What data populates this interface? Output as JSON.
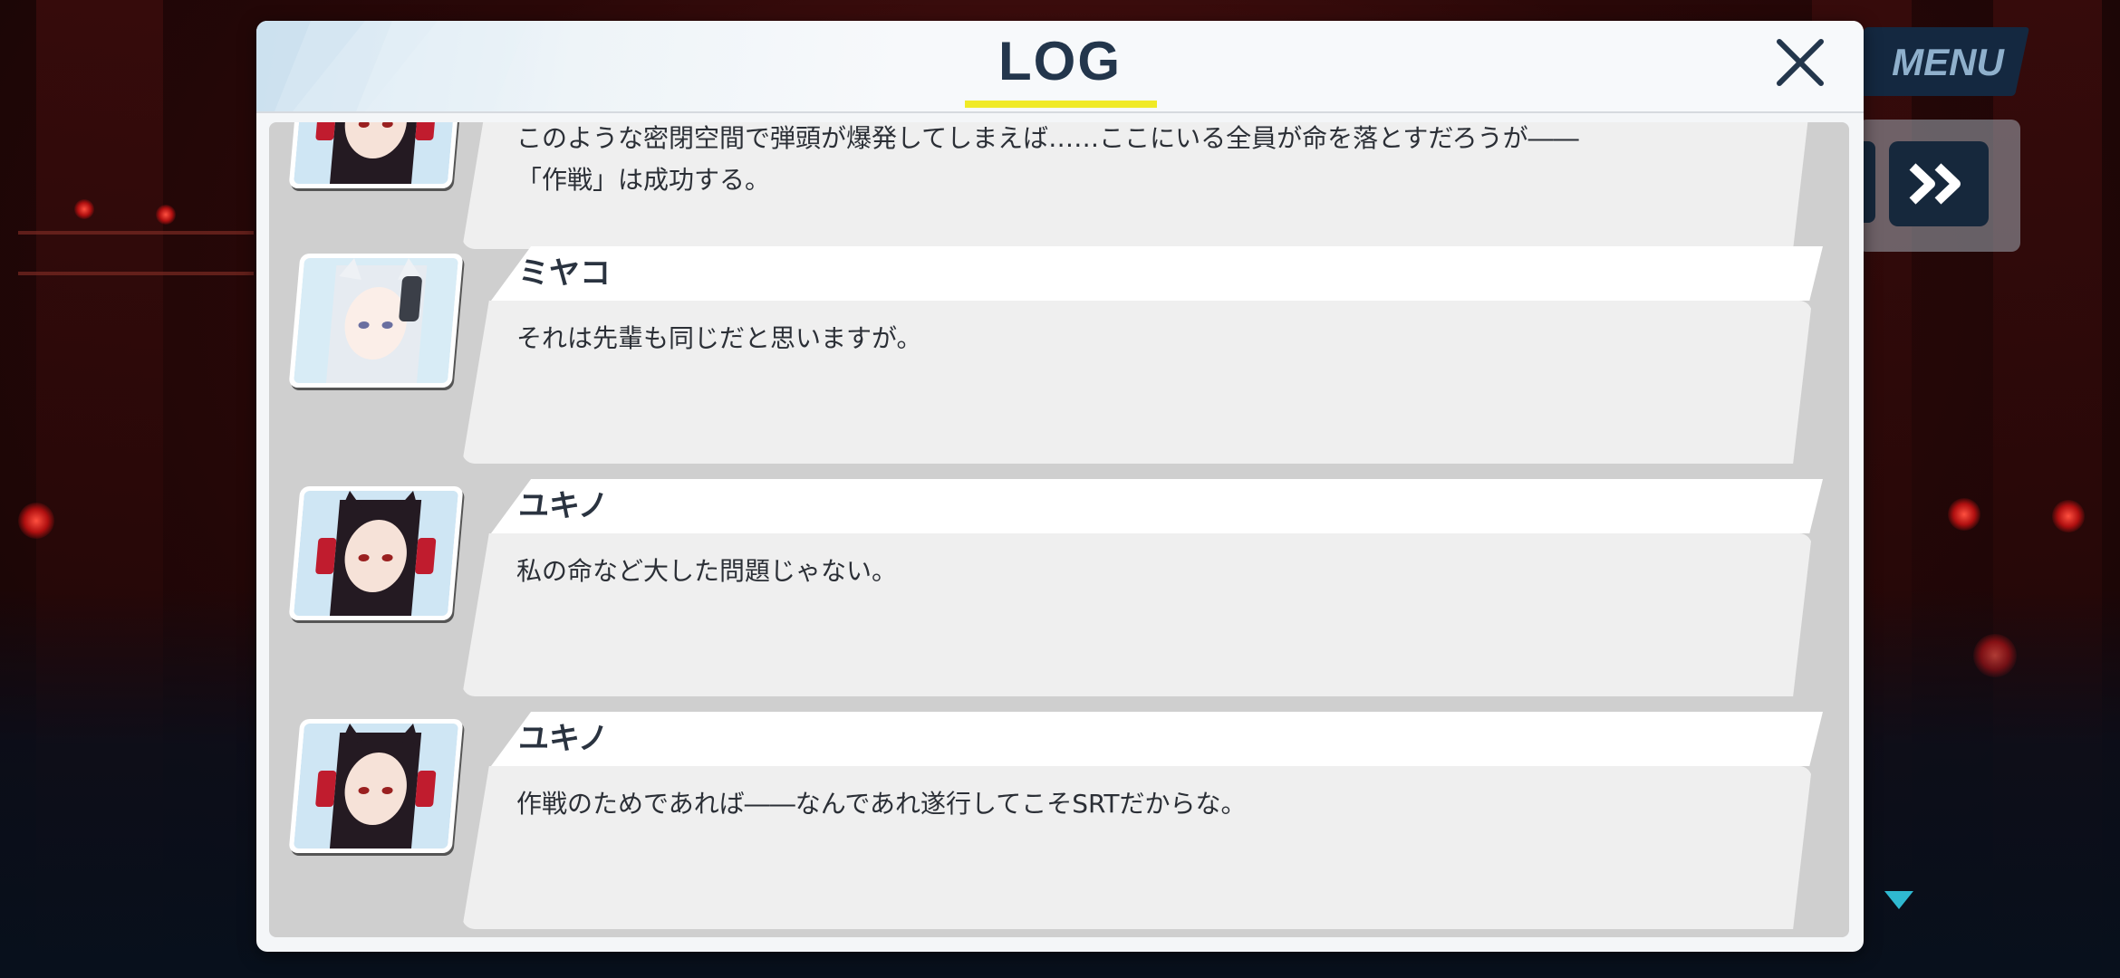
{
  "header": {
    "title": "LOG",
    "close_label": "×"
  },
  "controls": {
    "menu_label": "MENU",
    "fast_forward_label": "»"
  },
  "entries": [
    {
      "speaker": "",
      "portrait": "yukino-portrait",
      "text": "このような密閉空間で弾頭が爆発してしまえば……ここにいる全員が命を落とすだろうが――\n「作戦」は成功する。"
    },
    {
      "speaker": "ミヤコ",
      "portrait": "miyako-portrait",
      "text": "それは先輩も同じだと思いますが。"
    },
    {
      "speaker": "ユキノ",
      "portrait": "yukino-portrait",
      "text": "私の命など大した問題じゃない。"
    },
    {
      "speaker": "ユキノ",
      "portrait": "yukino-portrait",
      "text": "作戦のためであれば――なんであれ遂行してこそSRTだからな。"
    }
  ],
  "colors": {
    "title": "#23364c",
    "underline": "#f0ea26",
    "menu_bg": "#142840",
    "scroll_indicator": "#2fb8d0"
  }
}
